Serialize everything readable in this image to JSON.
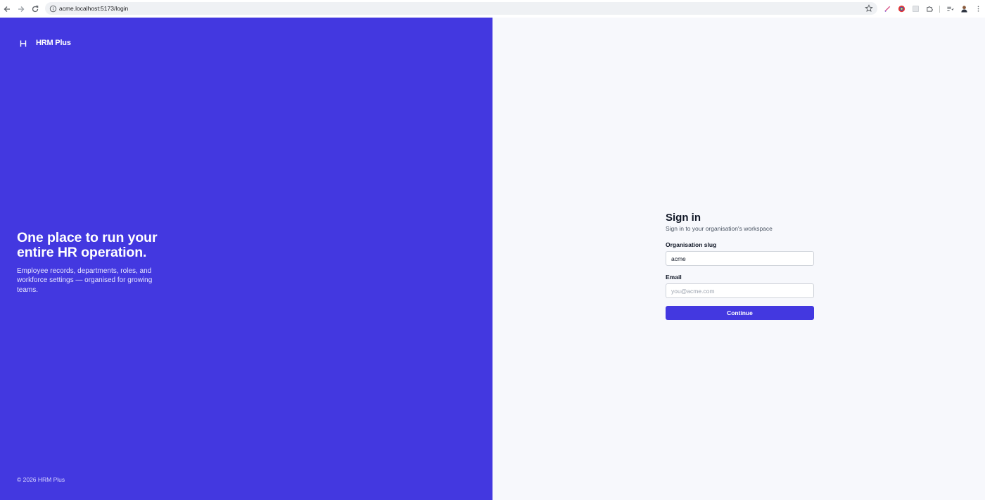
{
  "browser": {
    "url": "acme.localhost:5173/login",
    "icons": [
      "back-arrow-icon",
      "forward-arrow-icon",
      "reload-icon",
      "site-info-icon",
      "bookmark-star-icon",
      "pen-extension-icon",
      "color-extension-icon",
      "extension-icon",
      "puzzle-icon",
      "reading-list-icon",
      "profile-avatar-icon",
      "kebab-menu-icon"
    ]
  },
  "brand": {
    "logo_text": "HRM Plus",
    "hero_title": "One place to run your entire HR operation.",
    "hero_subtitle": "Employee records, departments, roles, and workforce settings — organised for growing teams.",
    "copyright": "© 2026 HRM Plus",
    "accent_color": "#4338e0"
  },
  "form": {
    "title": "Sign in",
    "subtitle": "Sign in to your organisation's workspace",
    "org_label": "Organisation slug",
    "org_value": "acme",
    "email_label": "Email",
    "email_placeholder": "you@acme.com",
    "submit_label": "Continue"
  }
}
